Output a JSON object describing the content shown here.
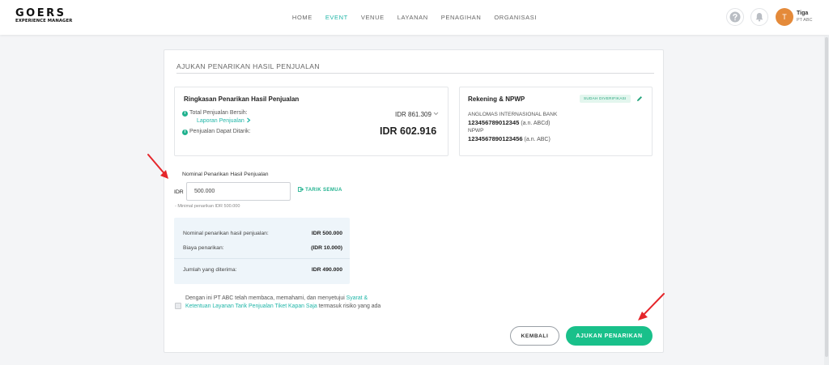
{
  "brand": {
    "line1": "GOERS",
    "line2": "EXPERIENCE MANAGER"
  },
  "nav": [
    {
      "label": "HOME",
      "active": false
    },
    {
      "label": "EVENT",
      "active": true
    },
    {
      "label": "VENUE",
      "active": false
    },
    {
      "label": "LAYANAN",
      "active": false
    },
    {
      "label": "PENAGIHAN",
      "active": false
    },
    {
      "label": "ORGANISASI",
      "active": false
    }
  ],
  "header_icons": [
    "help-icon",
    "bell-icon"
  ],
  "user": {
    "initial": "T",
    "name": "Tiga",
    "company": "PT ABC"
  },
  "colors": {
    "accent": "#21b6a8",
    "primary_button": "#19c08a",
    "avatar": "#e48a3a",
    "arrow": "#e5262b"
  },
  "page": {
    "title": "AJUKAN PENARIKAN HASIL PENJUALAN"
  },
  "summary": {
    "title": "Ringkasan Penarikan Hasil Penjualan",
    "net_label": "Total Penjualan Bersih:",
    "net_value": "IDR 861.309",
    "report_link": "Laporan Penjualan",
    "withdrawable_label": "Penjualan Dapat Ditarik:",
    "withdrawable_value": "IDR 602.916"
  },
  "account": {
    "title": "Rekening & NPWP",
    "verified_badge": "SUDAH DIVERIFIKASI",
    "bank_name": "ANGLOMAS INTERNASIONAL BANK",
    "account_number": "123456789012345",
    "account_holder": "(a.n. ABCd)",
    "npwp_label": "NPWP",
    "npwp_number": "1234567890123456",
    "npwp_holder": "(a.n. ABC)"
  },
  "nominal": {
    "label": "Nominal Penarikan Hasil Penjualan",
    "currency": "IDR",
    "value": "500.000",
    "withdraw_all": "TARIK SEMUA",
    "hint": "- Minimal penarikan IDR 500.000"
  },
  "breakdown": {
    "rows": [
      {
        "label": "Nominal penarikan hasil penjualan:",
        "value": "IDR 500.000"
      },
      {
        "label": "Biaya penarikan:",
        "value": "(IDR 10.000)"
      }
    ],
    "total_label": "Jumlah yang diterima:",
    "total_value": "IDR 490.000"
  },
  "agreement": {
    "checked": false,
    "text_before": "Dengan ini PT ABC telah membaca, memahami, dan menyetujui ",
    "link": "Syarat & Ketentuan Layanan Tarik Penjualan Tiket Kapan Saja",
    "text_after": " termasuk risiko yang ada"
  },
  "actions": {
    "back": "KEMBALI",
    "submit": "AJUKAN PENARIKAN"
  }
}
